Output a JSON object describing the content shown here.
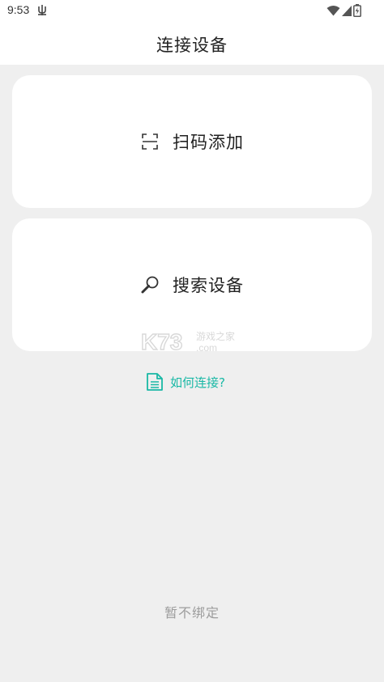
{
  "status_bar": {
    "time": "9:53",
    "icons": [
      "bug-notification-icon",
      "wifi-icon",
      "signal-icon",
      "battery-charging-icon"
    ]
  },
  "app_bar": {
    "title": "连接设备"
  },
  "cards": {
    "scan": {
      "label": "扫码添加",
      "icon": "scan-icon"
    },
    "search": {
      "label": "搜索设备",
      "icon": "search-icon"
    }
  },
  "watermark": {
    "brand": "K73",
    "subtitle": "游戏之家",
    "domain": ".com"
  },
  "help_link": {
    "label": "如何连接?",
    "icon": "document-icon"
  },
  "skip": {
    "label": "暂不绑定"
  },
  "colors": {
    "accent": "#19b8a5",
    "background": "#efefef",
    "card": "#ffffff",
    "muted_text": "#9c9c9c"
  }
}
